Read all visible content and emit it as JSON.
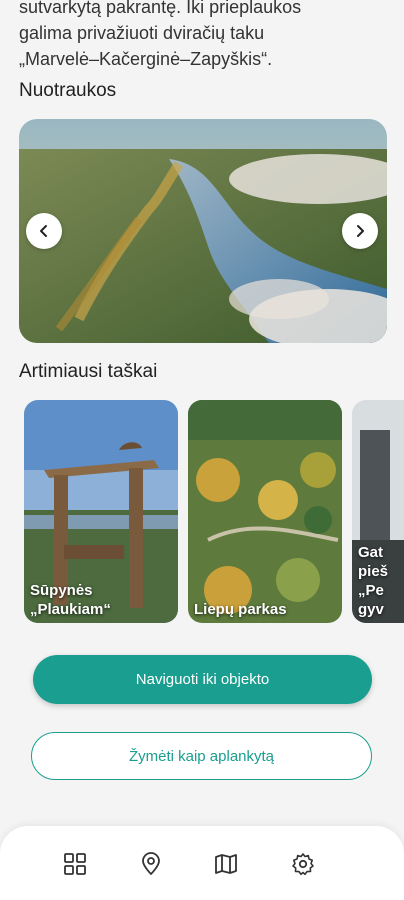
{
  "intro": {
    "line1": "sutvarkytą pakrantę. Iki prieplaukos",
    "line2": "galima privažiuoti dviračių taku",
    "line3": "„Marvelė–Kačerginė–Zapyškis“."
  },
  "photos": {
    "heading": "Nuotraukos"
  },
  "nearby": {
    "heading": "Artimiausi taškai",
    "cards": [
      {
        "label_line1": "Sūpynės",
        "label_line2": "„Plaukiam“"
      },
      {
        "label_line1": "Liepų parkas",
        "label_line2": ""
      },
      {
        "label_line1": "Gat",
        "label_line2": "pieš",
        "label_line3": "„Pe",
        "label_line4": "gyv"
      }
    ]
  },
  "actions": {
    "navigate": "Naviguoti iki objekto",
    "mark_visited": "Žymėti kaip aplankytą"
  },
  "nav": {
    "items": [
      {
        "icon": "grid-icon"
      },
      {
        "icon": "location-pin-icon"
      },
      {
        "icon": "map-icon"
      },
      {
        "icon": "settings-icon"
      }
    ]
  },
  "colors": {
    "accent": "#1a9e8f"
  }
}
